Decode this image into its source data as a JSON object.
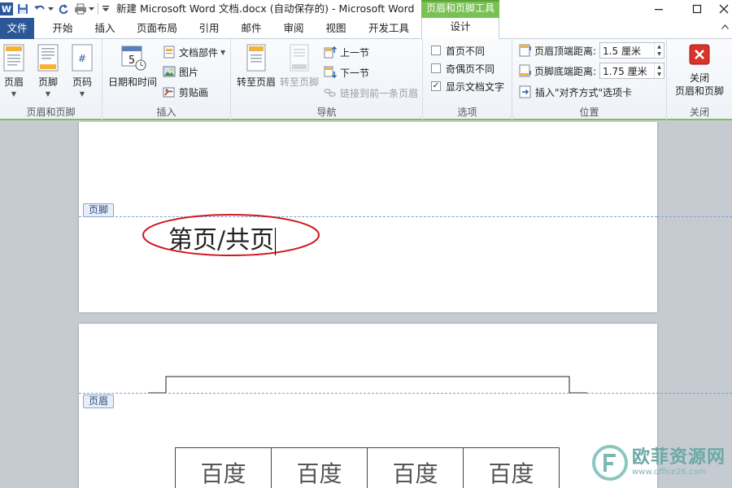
{
  "window": {
    "title": "新建 Microsoft Word 文档.docx (自动保存的)  -  Microsoft Word",
    "context_tool": "页眉和页脚工具",
    "app_icon_letter": "W"
  },
  "tabs": {
    "file": "文件",
    "items": [
      "开始",
      "插入",
      "页面布局",
      "引用",
      "邮件",
      "审阅",
      "视图",
      "开发工具"
    ],
    "design": "设计"
  },
  "ribbon": {
    "hf_group": {
      "label": "页眉和页脚",
      "header": "页眉",
      "footer": "页脚",
      "page_number": "页码"
    },
    "insert_group": {
      "label": "插入",
      "date_time": "日期和时间",
      "doc_parts": "文档部件",
      "picture": "图片",
      "clipart": "剪贴画"
    },
    "nav_group": {
      "label": "导航",
      "goto_header": "转至页眉",
      "goto_footer": "转至页脚",
      "prev_section": "上一节",
      "next_section": "下一节",
      "link_prev": "链接到前一条页眉"
    },
    "options_group": {
      "label": "选项",
      "first_page": "首页不同",
      "odd_even": "奇偶页不同",
      "show_text": "显示文档文字",
      "first_page_checked": false,
      "odd_even_checked": false,
      "show_text_checked": true
    },
    "position_group": {
      "label": "位置",
      "header_top": "页眉顶端距离:",
      "header_top_value": "1.5 厘米",
      "footer_bottom": "页脚底端距离:",
      "footer_bottom_value": "1.75 厘米",
      "insert_align": "插入\"对齐方式\"选项卡"
    },
    "close_group": {
      "label": "关闭",
      "close_line1": "关闭",
      "close_line2": "页眉和页脚"
    }
  },
  "document": {
    "footer_tag": "页脚",
    "footer_text": "第页/共页",
    "header_tag": "页眉",
    "table_cells": [
      "百度",
      "百度",
      "百度",
      "百度"
    ]
  },
  "watermark": {
    "name": "欧菲资源网",
    "url": "www.office26.com"
  },
  "colors": {
    "file_tab": "#2b5797",
    "context_green": "#79c153",
    "highlight_ellipse": "#d0181f",
    "dashed_line": "#7ea0d4"
  }
}
